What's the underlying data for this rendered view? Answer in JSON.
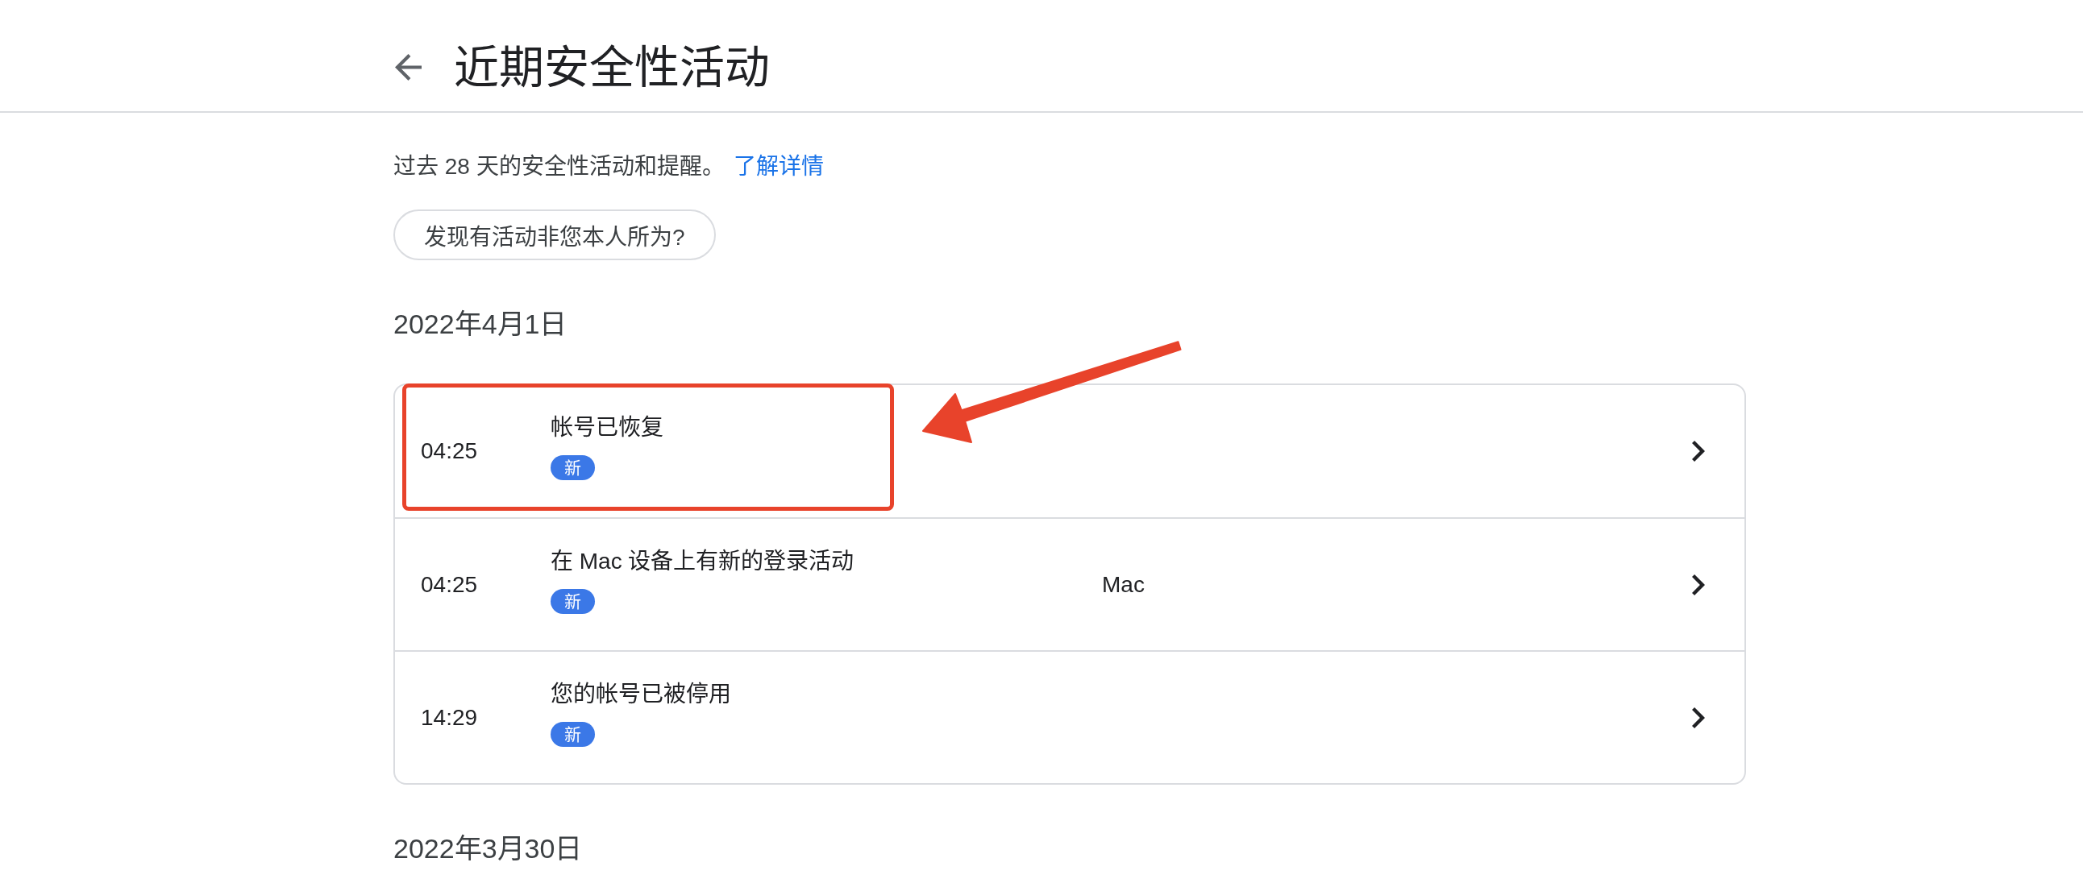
{
  "header": {
    "title": "近期安全性活动"
  },
  "intro": {
    "text": "过去 28 天的安全性活动和提醒。",
    "link": "了解详情"
  },
  "report_button": {
    "label": "发现有活动非您本人所为?"
  },
  "sections": [
    {
      "date": "2022年4月1日",
      "events": [
        {
          "time": "04:25",
          "title": "帐号已恢复",
          "badge": "新",
          "highlighted": true
        },
        {
          "time": "04:25",
          "title": "在 Mac 设备上有新的登录活动",
          "badge": "新",
          "device": "Mac",
          "highlighted": false
        },
        {
          "time": "14:29",
          "title": "您的帐号已被停用",
          "badge": "新",
          "highlighted": false
        }
      ]
    },
    {
      "date": "2022年3月30日"
    }
  ]
}
